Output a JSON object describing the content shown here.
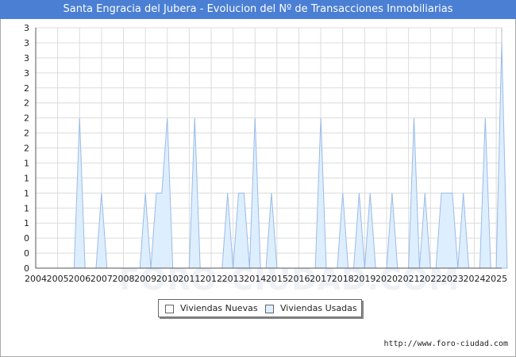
{
  "title": "Santa Engracia del Jubera - Evolucion del Nº de Transacciones Inmobiliarias",
  "url": "http://www.foro-ciudad.com",
  "watermark": "FORO-CIUDAD.COM",
  "colors": {
    "title_bg": "#4a7fd4",
    "nuevas": "#ffffff",
    "usadas_fill": "#ddeeff",
    "usadas_line": "#9bbbe8"
  },
  "chart_data": {
    "type": "area",
    "title": "Santa Engracia del Jubera - Evolucion del Nº de Transacciones Inmobiliarias",
    "xlabel": "",
    "ylabel": "",
    "ylim": [
      0,
      3.2
    ],
    "grid": true,
    "legend_position": "bottom",
    "x_ticks": [
      "2004",
      "2005",
      "2006",
      "2007",
      "2008",
      "2009",
      "2010",
      "2011",
      "2012",
      "2013",
      "2014",
      "2015",
      "2016",
      "2017",
      "2018",
      "2019",
      "2020",
      "2021",
      "2022",
      "2023",
      "2024",
      "2025"
    ],
    "y_ticks": [
      "0",
      "0",
      "0",
      "1",
      "1",
      "1",
      "1",
      "1",
      "2",
      "2",
      "2",
      "2",
      "2",
      "3",
      "3",
      "3",
      "3"
    ],
    "y_tick_values": [
      0,
      0.2,
      0.4,
      0.6,
      0.8,
      1.0,
      1.2,
      1.4,
      1.6,
      1.8,
      2.0,
      2.2,
      2.4,
      2.6,
      2.8,
      3.0,
      3.2
    ],
    "series": [
      {
        "name": "Viviendas Nuevas",
        "points": []
      },
      {
        "name": "Viviendas Usadas",
        "points": [
          [
            2005.75,
            0
          ],
          [
            2006.0,
            2
          ],
          [
            2006.25,
            0
          ],
          [
            2006.75,
            0
          ],
          [
            2007.0,
            1
          ],
          [
            2007.25,
            0
          ],
          [
            2008.75,
            0
          ],
          [
            2009.0,
            1
          ],
          [
            2009.25,
            0
          ],
          [
            2009.5,
            1
          ],
          [
            2009.75,
            1
          ],
          [
            2010.0,
            2
          ],
          [
            2010.25,
            0
          ],
          [
            2011.0,
            0
          ],
          [
            2011.25,
            2
          ],
          [
            2011.5,
            0
          ],
          [
            2012.5,
            0
          ],
          [
            2012.75,
            1
          ],
          [
            2013.0,
            0
          ],
          [
            2013.25,
            1
          ],
          [
            2013.5,
            1
          ],
          [
            2013.75,
            0
          ],
          [
            2014.0,
            2
          ],
          [
            2014.25,
            0
          ],
          [
            2014.5,
            0
          ],
          [
            2014.75,
            1
          ],
          [
            2015.0,
            0
          ],
          [
            2016.75,
            0
          ],
          [
            2017.0,
            2
          ],
          [
            2017.25,
            0
          ],
          [
            2017.75,
            0
          ],
          [
            2018.0,
            1
          ],
          [
            2018.25,
            0
          ],
          [
            2018.5,
            0
          ],
          [
            2018.75,
            1
          ],
          [
            2019.0,
            0
          ],
          [
            2019.25,
            1
          ],
          [
            2019.5,
            0
          ],
          [
            2020.0,
            0
          ],
          [
            2020.25,
            1
          ],
          [
            2020.5,
            0
          ],
          [
            2021.0,
            0
          ],
          [
            2021.25,
            2
          ],
          [
            2021.5,
            0
          ],
          [
            2021.75,
            1
          ],
          [
            2022.0,
            0
          ],
          [
            2022.25,
            0
          ],
          [
            2022.5,
            1
          ],
          [
            2022.75,
            1
          ],
          [
            2023.0,
            1
          ],
          [
            2023.25,
            0
          ],
          [
            2023.5,
            1
          ],
          [
            2023.75,
            0
          ],
          [
            2024.25,
            0
          ],
          [
            2024.5,
            2
          ],
          [
            2024.75,
            0
          ],
          [
            2025.0,
            0
          ],
          [
            2025.25,
            3
          ],
          [
            2025.5,
            0
          ]
        ]
      }
    ]
  }
}
